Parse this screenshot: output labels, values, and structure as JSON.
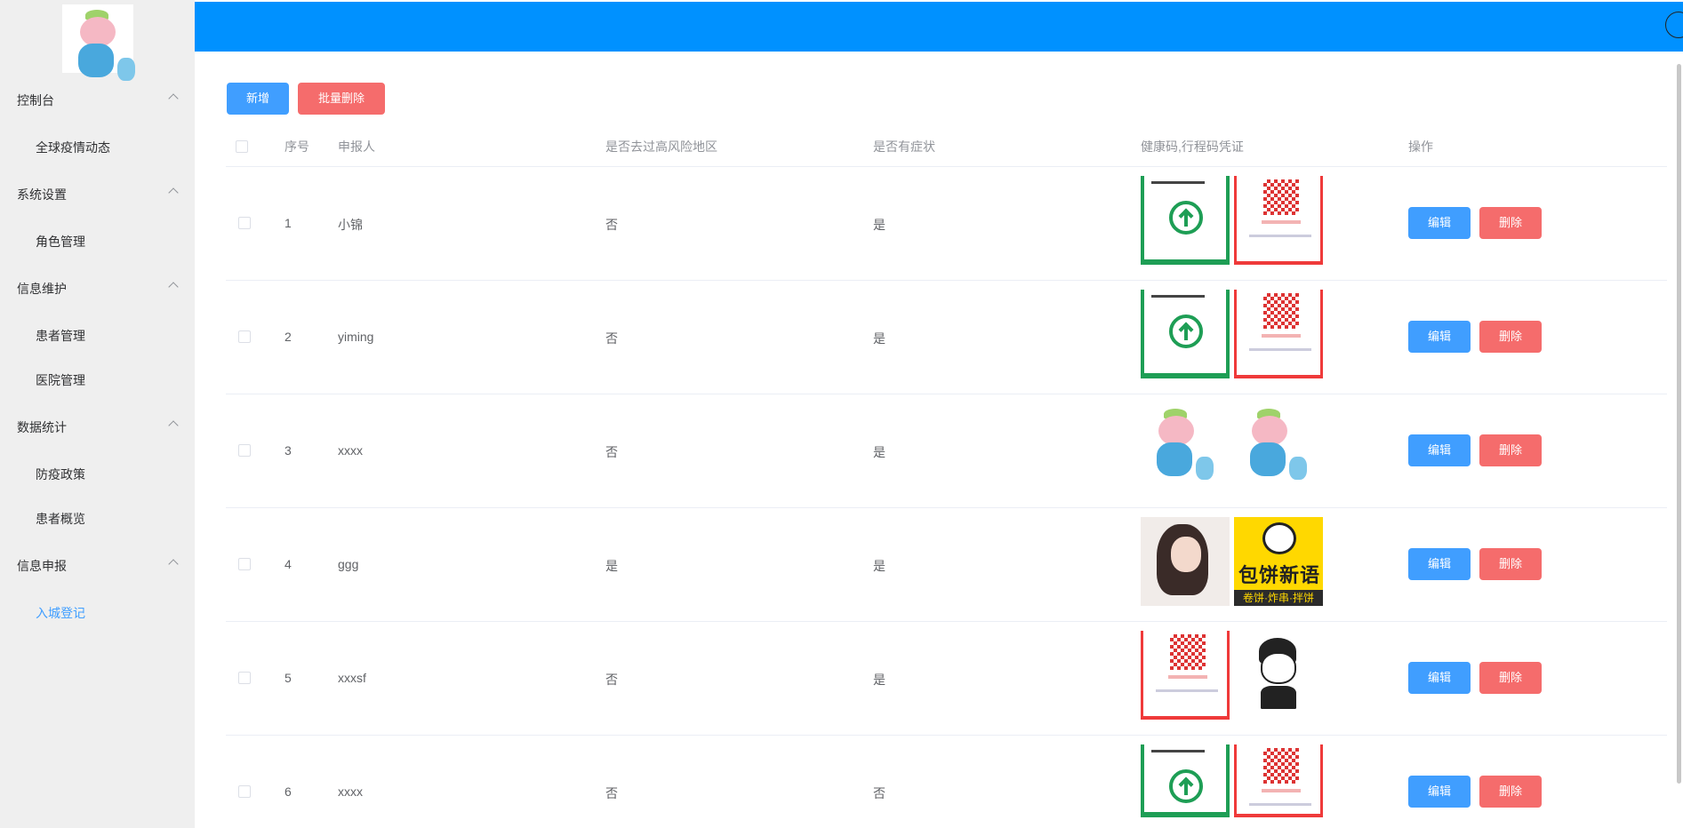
{
  "sidebar": {
    "logo_name": "pig-mascot-logo",
    "groups": [
      {
        "label": "控制台",
        "items": [
          "全球疫情动态"
        ]
      },
      {
        "label": "系统设置",
        "items": [
          "角色管理"
        ]
      },
      {
        "label": "信息维护",
        "items": [
          "患者管理",
          "医院管理"
        ]
      },
      {
        "label": "数据统计",
        "items": [
          "防疫政策",
          "患者概览"
        ]
      },
      {
        "label": "信息申报",
        "items": [
          "入城登记"
        ]
      }
    ],
    "active_item": "入城登记"
  },
  "header": {
    "color": "#0091ff",
    "right_icon": "circle-icon"
  },
  "toolbar": {
    "add_label": "新增",
    "batch_delete_label": "批量删除"
  },
  "table": {
    "columns": [
      "序号",
      "申报人",
      "是否去过高风险地区",
      "是否有症状",
      "健康码,行程码凭证",
      "操作"
    ],
    "rows": [
      {
        "id": "1",
        "name": "小锦",
        "high_risk": "否",
        "symptom": "是",
        "images": [
          "green-health-code",
          "red-travel-qr"
        ]
      },
      {
        "id": "2",
        "name": "yiming",
        "high_risk": "否",
        "symptom": "是",
        "images": [
          "green-health-code",
          "red-travel-qr"
        ]
      },
      {
        "id": "3",
        "name": "xxxx",
        "high_risk": "否",
        "symptom": "是",
        "images": [
          "pig-toy-photo",
          "pig-toy-photo"
        ]
      },
      {
        "id": "4",
        "name": "ggg",
        "high_risk": "是",
        "symptom": "是",
        "images": [
          "girl-portrait",
          "snack-logo"
        ]
      },
      {
        "id": "5",
        "name": "xxxsf",
        "high_risk": "否",
        "symptom": "是",
        "images": [
          "red-travel-qr",
          "cartoon-boy"
        ]
      },
      {
        "id": "6",
        "name": "xxxx",
        "high_risk": "否",
        "symptom": "否",
        "images": [
          "green-health-code",
          "red-travel-qr"
        ]
      }
    ],
    "edit_label": "编辑",
    "delete_label": "删除"
  },
  "snack_logo": {
    "title": "包饼新语",
    "subtitle": "卷饼·炸串·拌饼"
  },
  "colors": {
    "primary": "#409eff",
    "danger": "#f56c6c",
    "active_menu": "#409eff"
  }
}
